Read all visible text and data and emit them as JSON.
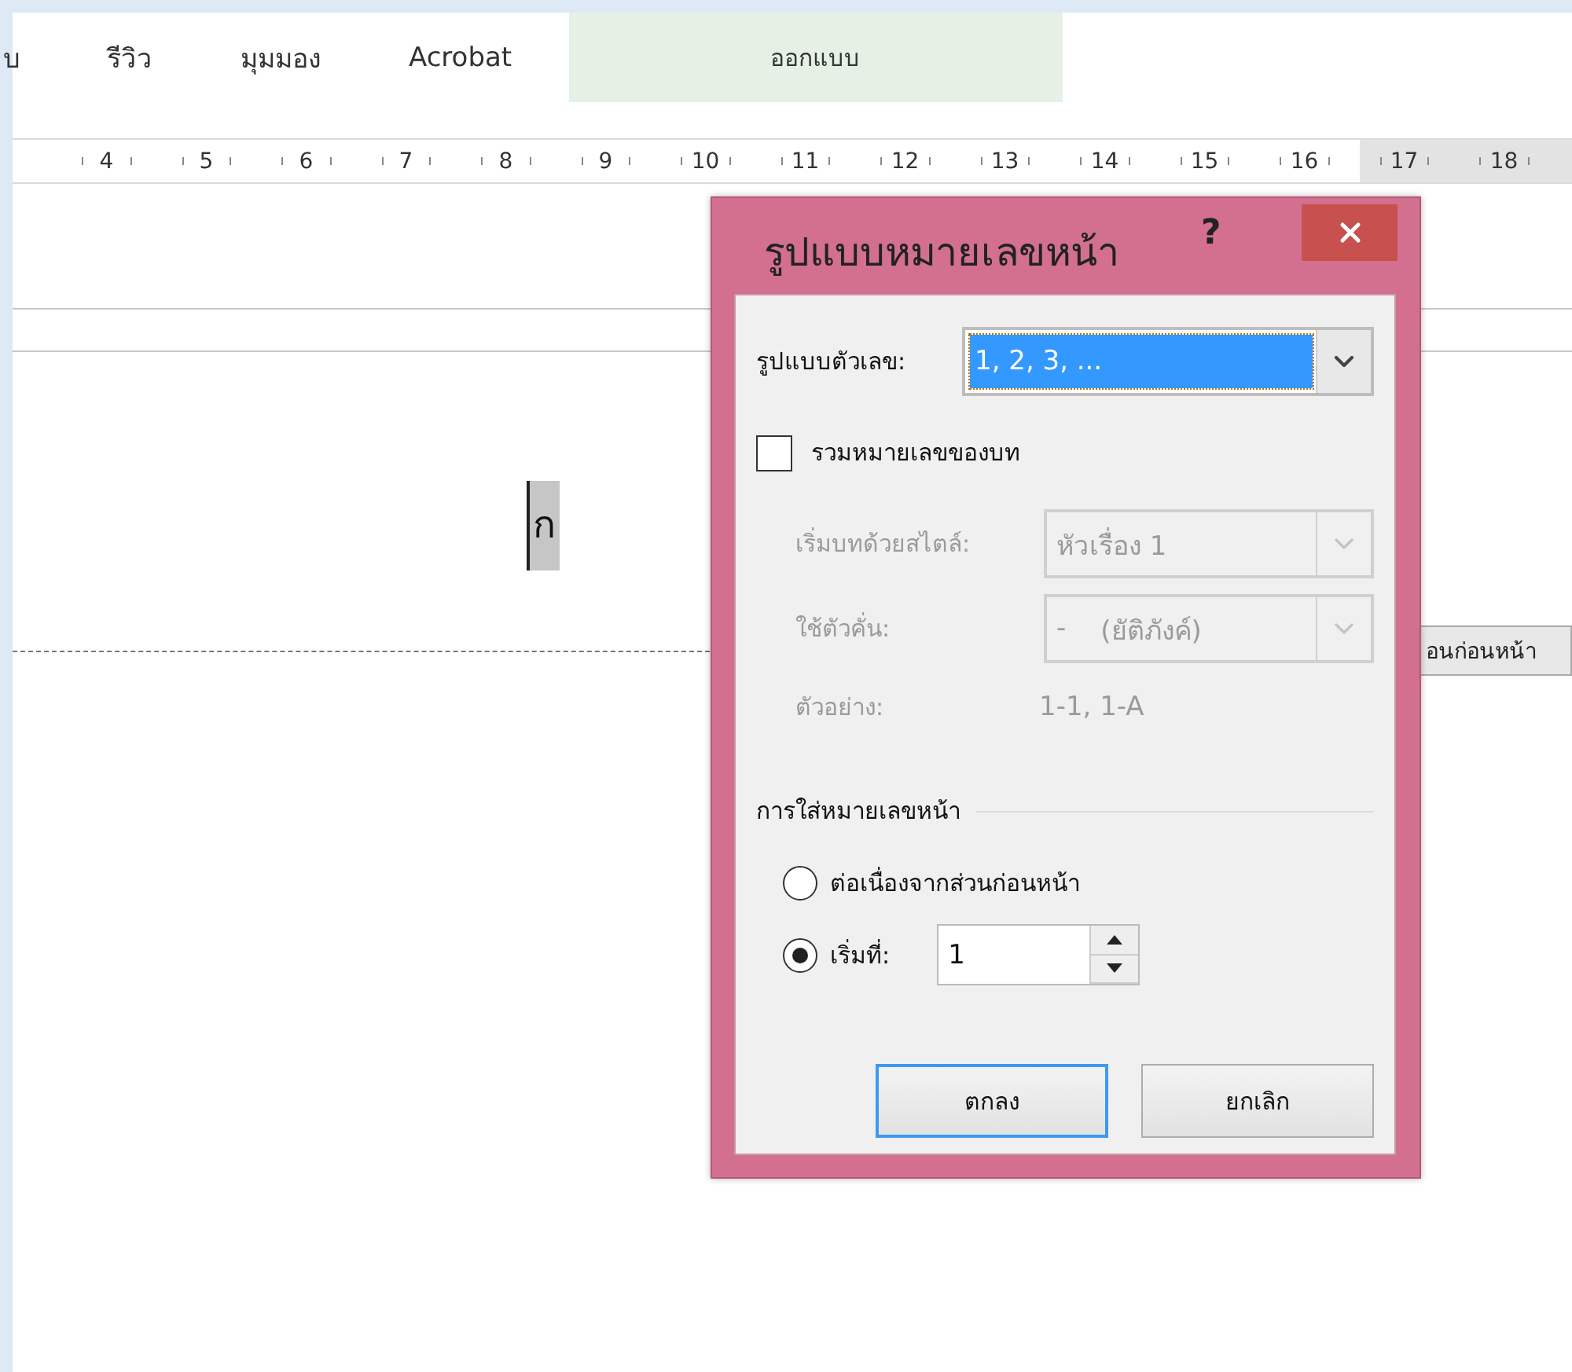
{
  "ribbon": {
    "tabs": [
      {
        "label": "บ",
        "kind": "plain"
      },
      {
        "label": "รีวิว",
        "kind": "plain"
      },
      {
        "label": "มุมมอง",
        "kind": "plain"
      },
      {
        "label": "Acrobat",
        "kind": "plain"
      },
      {
        "label": "ออกแบบ",
        "kind": "contextual"
      }
    ]
  },
  "ruler": {
    "numbers": [
      "4",
      "5",
      "6",
      "7",
      "8",
      "9",
      "10",
      "11",
      "12",
      "13",
      "14",
      "15",
      "16",
      "17",
      "18"
    ]
  },
  "document": {
    "text": "ก",
    "section_tag": "อนก่อนหน้า"
  },
  "dialog": {
    "title": "รูปแบบหมายเลขหน้า",
    "help": "?",
    "number_format": {
      "label": "รูปแบบตัวเลข:",
      "value": "1, 2, 3, ..."
    },
    "include_chapter": {
      "label": "รวมหมายเลขของบท",
      "checked": false
    },
    "chapter_options": [
      {
        "kind": "select",
        "label": "เริ่มบทด้วยสไตล์:",
        "value": "หัวเรื่อง 1",
        "disabled": true
      },
      {
        "kind": "select",
        "label": "ใช้ตัวคั่น:",
        "value": "-",
        "note": "(ยัติภังค์)",
        "disabled": true
      },
      {
        "kind": "example",
        "label": "ตัวอย่าง:",
        "value": "1-1, 1-A",
        "disabled": true
      }
    ],
    "numbering": {
      "title": "การใส่หมายเลขหน้า",
      "options": [
        {
          "label": "ต่อเนื่องจากส่วนก่อนหน้า",
          "selected": false
        },
        {
          "label": "เริ่มที่:",
          "selected": true,
          "value": "1"
        }
      ]
    },
    "buttons": [
      {
        "label": "ตกลง",
        "default": true
      },
      {
        "label": "ยกเลิก",
        "default": false
      }
    ]
  }
}
